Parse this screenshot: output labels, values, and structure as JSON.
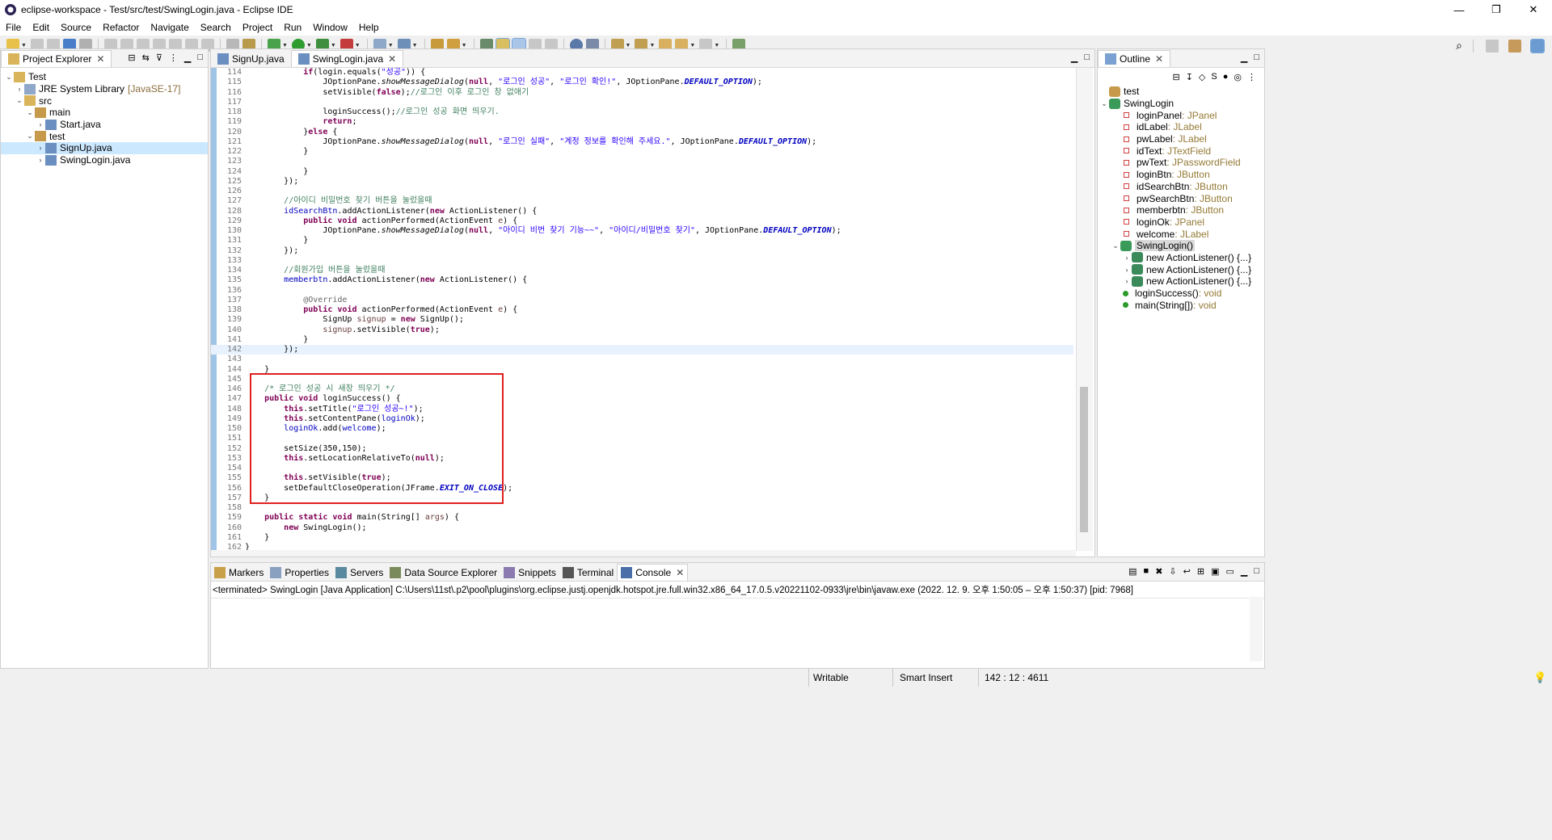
{
  "window": {
    "title": "eclipse-workspace - Test/src/test/SwingLogin.java - Eclipse IDE",
    "minimize": "—",
    "maximize": "❐",
    "close": "✕"
  },
  "menu": [
    "File",
    "Edit",
    "Source",
    "Refactor",
    "Navigate",
    "Search",
    "Project",
    "Run",
    "Window",
    "Help"
  ],
  "project_explorer": {
    "tab": "Project Explorer",
    "items": [
      {
        "label": "Test",
        "extra": "",
        "arrow": "v",
        "icon": "project-icon"
      },
      {
        "label": "JRE System Library",
        "extra": "[JavaSE-17]",
        "arrow": ">",
        "icon": "library-icon"
      },
      {
        "label": "src",
        "extra": "",
        "arrow": "v",
        "icon": "source-folder-icon"
      },
      {
        "label": "main",
        "extra": "",
        "arrow": "v",
        "icon": "package-icon"
      },
      {
        "label": "Start.java",
        "extra": "",
        "arrow": ">",
        "icon": "java-file-icon"
      },
      {
        "label": "test",
        "extra": "",
        "arrow": "v",
        "icon": "package-icon"
      },
      {
        "label": "SignUp.java",
        "extra": "",
        "arrow": ">",
        "icon": "java-file-icon"
      },
      {
        "label": "SwingLogin.java",
        "extra": "",
        "arrow": ">",
        "icon": "java-file-icon"
      }
    ]
  },
  "editor": {
    "tabs": [
      {
        "label": "SignUp.java",
        "active": false
      },
      {
        "label": "SwingLogin.java",
        "active": true
      }
    ]
  },
  "code_lines": [
    {
      "n": "114",
      "html": "            <span class=\"kw\">if</span>(login.equals(<span class=\"str\">\"성공\"</span>)) {"
    },
    {
      "n": "115",
      "html": "                JOptionPane.<span class=\"smeth\">showMessageDialog</span>(<span class=\"kw\">null</span>, <span class=\"str\">\"로그인 성공\"</span>, <span class=\"str\">\"로그인 확인!\"</span>, JOptionPane.<span class=\"sfld\">DEFAULT_OPTION</span>);"
    },
    {
      "n": "116",
      "html": "                setVisible(<span class=\"kw\">false</span>);<span class=\"cm\">//로그인 이후 로그인 창 없애기</span>"
    },
    {
      "n": "117",
      "html": ""
    },
    {
      "n": "118",
      "html": "                loginSuccess();<span class=\"cm\">//로그인 성공 화면 띄우기.</span>"
    },
    {
      "n": "119",
      "html": "                <span class=\"kw\">return</span>;"
    },
    {
      "n": "120",
      "html": "            }<span class=\"kw\">else</span> {"
    },
    {
      "n": "121",
      "html": "                JOptionPane.<span class=\"smeth\">showMessageDialog</span>(<span class=\"kw\">null</span>, <span class=\"str\">\"로그인 실패\"</span>, <span class=\"str\">\"계정 정보를 확인해 주세요.\"</span>, JOptionPane.<span class=\"sfld\">DEFAULT_OPTION</span>);"
    },
    {
      "n": "122",
      "html": "            }"
    },
    {
      "n": "123",
      "html": ""
    },
    {
      "n": "124",
      "html": "            }"
    },
    {
      "n": "125",
      "html": "        });"
    },
    {
      "n": "126",
      "html": ""
    },
    {
      "n": "127",
      "html": "        <span class=\"cm\">//아이디 비밀번호 찾기 버튼을 눌렀을때</span>"
    },
    {
      "n": "128",
      "html": "        <span class=\"fld\">idSearchBtn</span>.addActionListener(<span class=\"kw\">new</span> ActionListener() {"
    },
    {
      "n": "129",
      "html": "            <span class=\"kw\">public</span> <span class=\"kw\">void</span> actionPerformed(ActionEvent <span class=\"lv\">e</span>) {"
    },
    {
      "n": "130",
      "html": "                JOptionPane.<span class=\"smeth\">showMessageDialog</span>(<span class=\"kw\">null</span>, <span class=\"str\">\"아이디 비번 찾기 기능~~\"</span>, <span class=\"str\">\"아이디/비밀번호 찾기\"</span>, JOptionPane.<span class=\"sfld\">DEFAULT_OPTION</span>);"
    },
    {
      "n": "131",
      "html": "            }"
    },
    {
      "n": "132",
      "html": "        });"
    },
    {
      "n": "133",
      "html": ""
    },
    {
      "n": "134",
      "html": "        <span class=\"cm\">//회원가입 버튼을 눌렀을때</span>"
    },
    {
      "n": "135",
      "html": "        <span class=\"fld\">memberbtn</span>.addActionListener(<span class=\"kw\">new</span> ActionListener() {"
    },
    {
      "n": "136",
      "html": ""
    },
    {
      "n": "137",
      "html": "            <span class=\"ann\">@Override</span>"
    },
    {
      "n": "138",
      "html": "            <span class=\"kw\">public</span> <span class=\"kw\">void</span> actionPerformed(ActionEvent <span class=\"lv\">e</span>) {"
    },
    {
      "n": "139",
      "html": "                SignUp <span class=\"lv\">signup</span> = <span class=\"kw\">new</span> SignUp();"
    },
    {
      "n": "140",
      "html": "                <span class=\"lv\">signup</span>.setVisible(<span class=\"kw\">true</span>);"
    },
    {
      "n": "141",
      "html": "            }"
    },
    {
      "n": "142",
      "html": "        });"
    },
    {
      "n": "143",
      "html": ""
    },
    {
      "n": "144",
      "html": "    }"
    },
    {
      "n": "145",
      "html": ""
    },
    {
      "n": "146",
      "html": "    <span class=\"cm\">/* 로그인 성공 시 새창 띄우기 */</span>"
    },
    {
      "n": "147",
      "html": "    <span class=\"kw\">public</span> <span class=\"kw\">void</span> loginSuccess() {"
    },
    {
      "n": "148",
      "html": "        <span class=\"kw\">this</span>.setTitle(<span class=\"str\">\"로그인 성공~!\"</span>);"
    },
    {
      "n": "149",
      "html": "        <span class=\"kw\">this</span>.setContentPane(<span class=\"fld\">loginOk</span>);"
    },
    {
      "n": "150",
      "html": "        <span class=\"fld\">loginOk</span>.add(<span class=\"fld\">welcome</span>);"
    },
    {
      "n": "151",
      "html": ""
    },
    {
      "n": "152",
      "html": "        setSize(350,150);"
    },
    {
      "n": "153",
      "html": "        <span class=\"kw\">this</span>.setLocationRelativeTo(<span class=\"kw\">null</span>);"
    },
    {
      "n": "154",
      "html": ""
    },
    {
      "n": "155",
      "html": "        <span class=\"kw\">this</span>.setVisible(<span class=\"kw\">true</span>);"
    },
    {
      "n": "156",
      "html": "        setDefaultCloseOperation(JFrame.<span class=\"sfld\">EXIT_ON_CLOSE</span>);"
    },
    {
      "n": "157",
      "html": "    }"
    },
    {
      "n": "158",
      "html": ""
    },
    {
      "n": "159",
      "html": "    <span class=\"kw\">public</span> <span class=\"kw\">static</span> <span class=\"kw\">void</span> main(String[] <span class=\"lv\">args</span>) {"
    },
    {
      "n": "160",
      "html": "        <span class=\"kw\">new</span> SwingLogin();"
    },
    {
      "n": "161",
      "html": "    }"
    },
    {
      "n": "162",
      "html": "}"
    }
  ],
  "highlight_line": "142",
  "outline": {
    "tab": "Outline",
    "items": [
      {
        "label": "test",
        "type": "",
        "arrow": "",
        "indent": 1,
        "icon": "package-icon"
      },
      {
        "label": "SwingLogin",
        "type": "",
        "arrow": "v",
        "indent": 1,
        "icon": "class-icon"
      },
      {
        "label": "loginPanel",
        "type": " : JPanel",
        "arrow": "",
        "indent": 2,
        "icon": "private-field-icon"
      },
      {
        "label": "idLabel",
        "type": " : JLabel",
        "arrow": "",
        "indent": 2,
        "icon": "private-field-icon"
      },
      {
        "label": "pwLabel",
        "type": " : JLabel",
        "arrow": "",
        "indent": 2,
        "icon": "private-field-icon"
      },
      {
        "label": "idText",
        "type": " : JTextField",
        "arrow": "",
        "indent": 2,
        "icon": "private-field-icon"
      },
      {
        "label": "pwText",
        "type": " : JPasswordField",
        "arrow": "",
        "indent": 2,
        "icon": "private-field-icon"
      },
      {
        "label": "loginBtn",
        "type": " : JButton",
        "arrow": "",
        "indent": 2,
        "icon": "private-field-icon"
      },
      {
        "label": "idSearchBtn",
        "type": " : JButton",
        "arrow": "",
        "indent": 2,
        "icon": "private-field-icon"
      },
      {
        "label": "pwSearchBtn",
        "type": " : JButton",
        "arrow": "",
        "indent": 2,
        "icon": "private-field-icon"
      },
      {
        "label": "memberbtn",
        "type": " : JButton",
        "arrow": "",
        "indent": 2,
        "icon": "private-field-icon"
      },
      {
        "label": "loginOk",
        "type": " : JPanel",
        "arrow": "",
        "indent": 2,
        "icon": "private-field-icon"
      },
      {
        "label": "welcome",
        "type": " : JLabel",
        "arrow": "",
        "indent": 2,
        "icon": "private-field-icon"
      },
      {
        "label": "SwingLogin()",
        "type": "",
        "arrow": "v",
        "indent": 2,
        "icon": "constructor-icon",
        "selected": true
      },
      {
        "label": "new ActionListener() {...}",
        "type": "",
        "arrow": ">",
        "indent": 3,
        "icon": "anonymous-class-icon"
      },
      {
        "label": "new ActionListener() {...}",
        "type": "",
        "arrow": ">",
        "indent": 3,
        "icon": "anonymous-class-icon"
      },
      {
        "label": "new ActionListener() {...}",
        "type": "",
        "arrow": ">",
        "indent": 3,
        "icon": "anonymous-class-icon"
      },
      {
        "label": "loginSuccess()",
        "type": " : void",
        "arrow": "",
        "indent": 2,
        "icon": "public-method-icon"
      },
      {
        "label": "main(String[])",
        "type": " : void",
        "arrow": "",
        "indent": 2,
        "icon": "static-method-icon"
      }
    ]
  },
  "bottom_tabs": [
    {
      "label": "Markers",
      "icon": "markers-icon",
      "active": false
    },
    {
      "label": "Properties",
      "icon": "properties-icon",
      "active": false
    },
    {
      "label": "Servers",
      "icon": "servers-icon",
      "active": false
    },
    {
      "label": "Data Source Explorer",
      "icon": "data-source-icon",
      "active": false
    },
    {
      "label": "Snippets",
      "icon": "snippets-icon",
      "active": false
    },
    {
      "label": "Terminal",
      "icon": "terminal-icon",
      "active": false
    },
    {
      "label": "Console",
      "icon": "console-icon",
      "active": true
    }
  ],
  "console": {
    "header": "<terminated> SwingLogin [Java Application] C:\\Users\\11st\\.p2\\pool\\plugins\\org.eclipse.justj.openjdk.hotspot.jre.full.win32.x86_64_17.0.5.v20221102-0933\\jre\\bin\\javaw.exe  (2022. 12. 9. 오후 1:50:05 – 오후 1:50:37) [pid: 7968]"
  },
  "status": {
    "writable": "Writable",
    "insert_mode": "Smart Insert",
    "position": "142 : 12 : 4611"
  },
  "colors": {
    "keyword": "#7f0055",
    "string": "#2a00ff",
    "comment": "#3f7f5f",
    "field": "#0000c0",
    "highlight_box": "#e02020"
  }
}
